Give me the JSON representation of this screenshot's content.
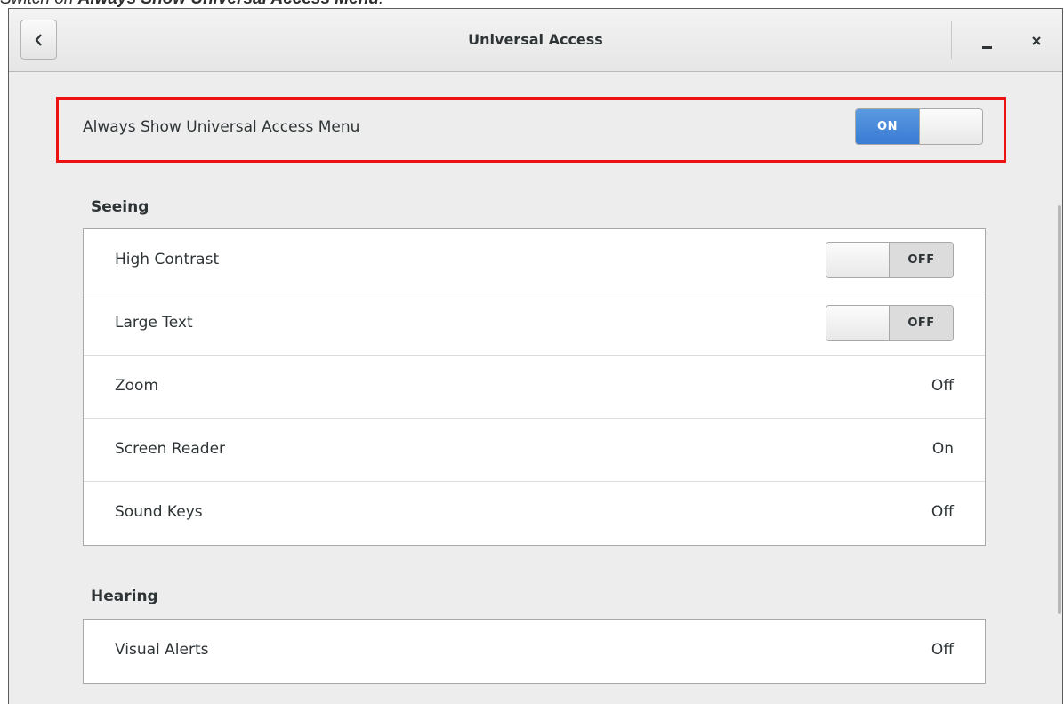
{
  "caption": {
    "prefix": "Switch on ",
    "bold": "Always Show Universal Access Menu",
    "suffix": "."
  },
  "window": {
    "title": "Universal Access",
    "back_icon": "chevron-left-icon",
    "minimize_icon": "minimize-icon",
    "close_icon": "close-icon"
  },
  "always_show_menu": {
    "label": "Always Show Universal Access Menu",
    "switch_text": "ON",
    "state": "on",
    "highlight_color": "#ee1111"
  },
  "sections": [
    {
      "heading": "Seeing",
      "rows": [
        {
          "label": "High Contrast",
          "type": "switch",
          "value": "OFF"
        },
        {
          "label": "Large Text",
          "type": "switch",
          "value": "OFF"
        },
        {
          "label": "Zoom",
          "type": "text",
          "value": "Off"
        },
        {
          "label": "Screen Reader",
          "type": "text",
          "value": "On"
        },
        {
          "label": "Sound Keys",
          "type": "text",
          "value": "Off"
        }
      ]
    },
    {
      "heading": "Hearing",
      "rows": [
        {
          "label": "Visual Alerts",
          "type": "text",
          "value": "Off"
        }
      ]
    }
  ],
  "colors": {
    "switch_on": "#3a7bd5",
    "window_bg": "#ededed",
    "text": "#2e3436"
  }
}
